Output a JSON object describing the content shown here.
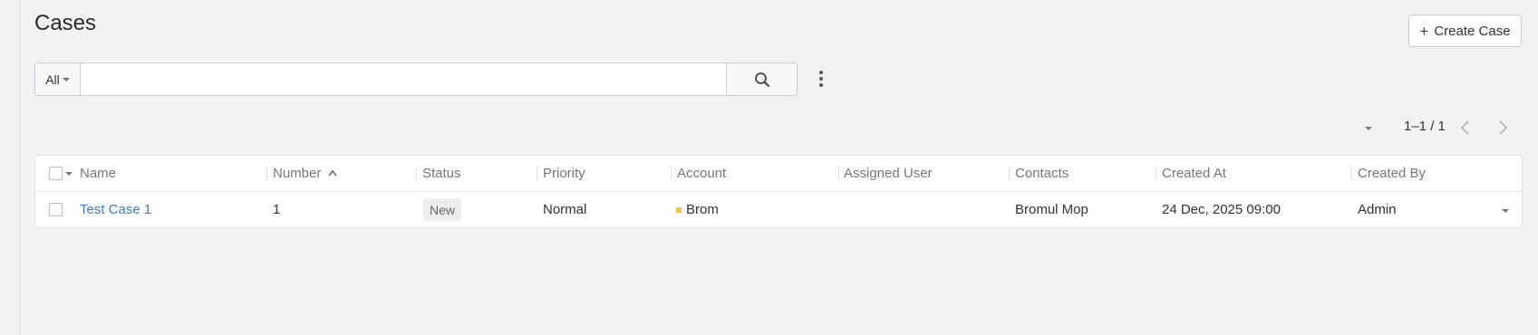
{
  "page": {
    "title": "Cases"
  },
  "toolbar": {
    "create_label": "Create Case"
  },
  "search": {
    "filter_label": "All",
    "placeholder": "",
    "value": ""
  },
  "pagination": {
    "label": "1–1 / 1"
  },
  "table": {
    "columns": [
      "Name",
      "Number",
      "Status",
      "Priority",
      "Account",
      "Assigned User",
      "Contacts",
      "Created At",
      "Created By"
    ],
    "sorted_by": "Number",
    "sort_direction": "asc",
    "rows": [
      {
        "name": "Test Case 1",
        "number": "1",
        "status": "New",
        "priority": "Normal",
        "account": "Brom",
        "assigned_user": "",
        "contacts": "Bromul Mop",
        "created_at": "24 Dec, 2025 09:00",
        "created_by": "Admin"
      }
    ]
  },
  "colors": {
    "link": "#3f7fc0",
    "account_dot": "#f0c34e",
    "background": "#f1f2f4"
  },
  "icons": [
    "plus-icon",
    "caret-down-icon",
    "search-icon",
    "kebab-menu-icon",
    "chevron-left-icon",
    "chevron-right-icon",
    "sort-asc-icon"
  ]
}
